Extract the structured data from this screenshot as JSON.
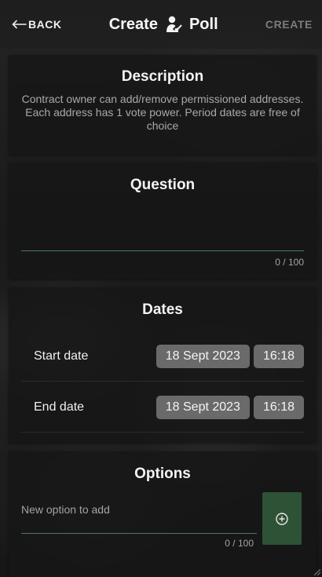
{
  "header": {
    "back_label": "BACK",
    "title_left": "Create",
    "title_right": "Poll",
    "create_label": "CREATE"
  },
  "description": {
    "title": "Description",
    "text": "Contract owner can add/remove permissioned addresses. Each address has 1 vote power. Period dates are free of choice"
  },
  "question": {
    "title": "Question",
    "value": "",
    "counter": "0 / 100"
  },
  "dates": {
    "title": "Dates",
    "start": {
      "label": "Start date",
      "date": "18 Sept 2023",
      "time": "16:18"
    },
    "end": {
      "label": "End date",
      "date": "18 Sept 2023",
      "time": "16:18"
    }
  },
  "options": {
    "title": "Options",
    "placeholder": "New option to add",
    "counter": "0 / 100"
  },
  "colors": {
    "accent_green": "#2e5236",
    "underline_green": "#4c7a5a",
    "chip_gray": "#6a6a6a"
  }
}
